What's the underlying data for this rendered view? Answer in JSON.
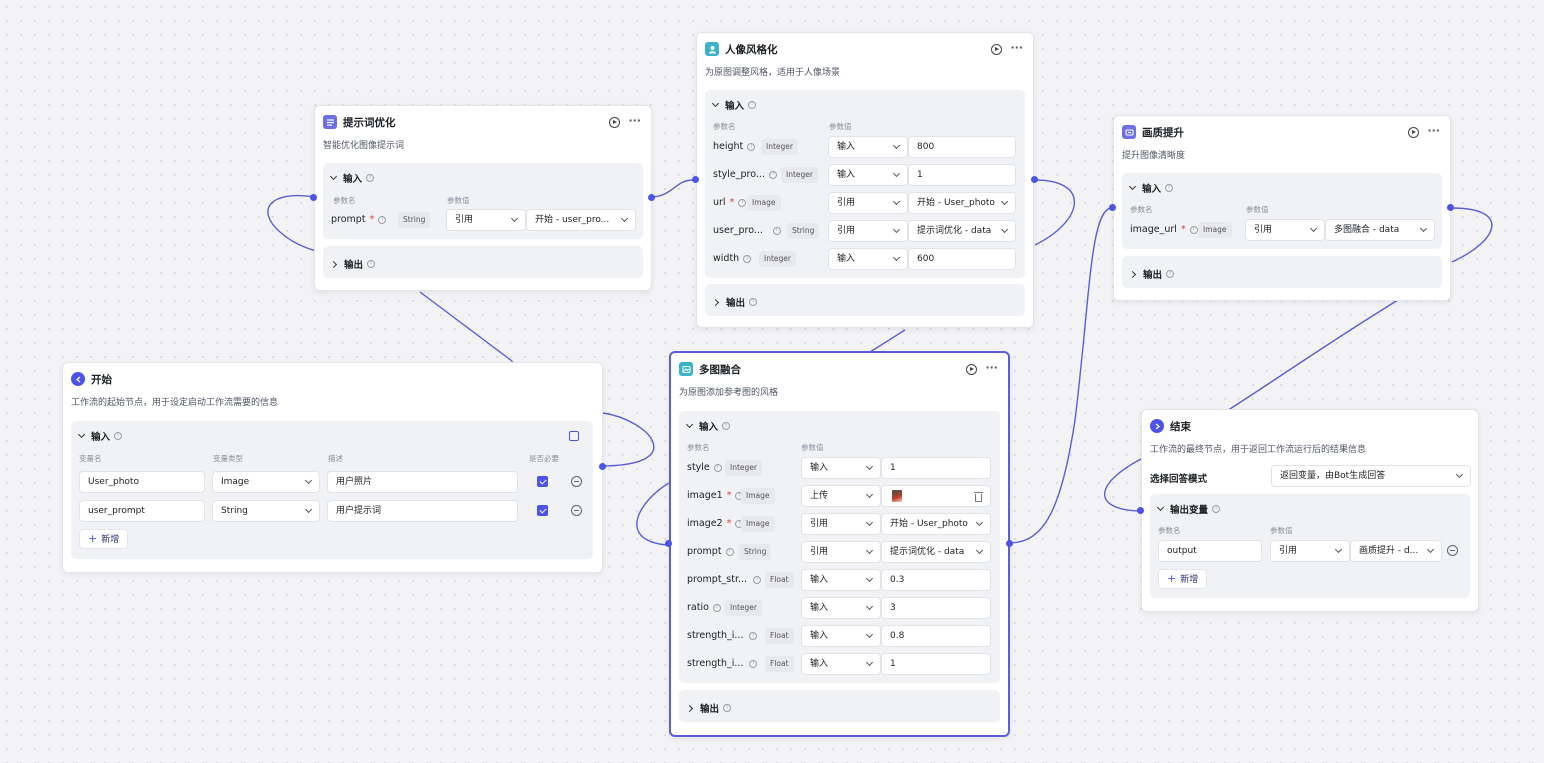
{
  "colors": {
    "accent": "#4d53e8",
    "edge": "#5b5fd6",
    "canvas": "#f3f3f6"
  },
  "nodes": {
    "prompt_opt": {
      "title": "提示词优化",
      "icon": "list-icon",
      "icon_color": "#6d6ee8",
      "desc": "智能优化图像提示词",
      "input_label": "输入",
      "col_name": "参数名",
      "col_value": "参数值",
      "params": [
        {
          "name": "prompt",
          "type": "String",
          "mode": "引用",
          "value": "开始 - user_pro..."
        }
      ],
      "output_label": "输出"
    },
    "portrait": {
      "title": "人像风格化",
      "icon": "person-icon",
      "icon_color": "#38b3c9",
      "desc": "为原图调整风格，适用于人像场景",
      "input_label": "输入",
      "col_name": "参数名",
      "col_value": "参数值",
      "params": [
        {
          "name": "height",
          "type": "Integer",
          "mode": "输入",
          "value": "800"
        },
        {
          "name": "style_pro...",
          "type": "Integer",
          "mode": "输入",
          "value": "1"
        },
        {
          "name": "url",
          "type": "Image",
          "mode": "引用",
          "value": "开始 - User_photo"
        },
        {
          "name": "user_pro...",
          "type": "String",
          "mode": "引用",
          "value": "提示词优化 - data"
        },
        {
          "name": "width",
          "type": "Integer",
          "mode": "输入",
          "value": "600"
        }
      ],
      "output_label": "输出"
    },
    "quality": {
      "title": "画质提升",
      "icon": "image-quality-icon",
      "icon_color": "#6d6ee8",
      "desc": "提升图像清晰度",
      "input_label": "输入",
      "col_name": "参数名",
      "col_value": "参数值",
      "params": [
        {
          "name": "image_url",
          "type": "Image",
          "mode": "引用",
          "value": "多图融合 - data"
        }
      ],
      "output_label": "输出"
    },
    "start": {
      "title": "开始",
      "icon": "start-icon",
      "icon_color": "#4d53e8",
      "desc": "工作流的起始节点，用于设定启动工作流需要的信息",
      "input_label": "输入",
      "cols": [
        "变量名",
        "变量类型",
        "描述",
        "是否必要"
      ],
      "rows": [
        {
          "name": "User_photo",
          "type": "Image",
          "desc": "用户照片"
        },
        {
          "name": "user_prompt",
          "type": "String",
          "desc": "用户提示词"
        }
      ],
      "add_label": "新增"
    },
    "fusion": {
      "title": "多图融合",
      "icon": "fusion-icon",
      "icon_color": "#38b3c9",
      "desc": "为原图添加参考图的风格",
      "input_label": "输入",
      "col_name": "参数名",
      "col_value": "参数值",
      "params": [
        {
          "name": "style",
          "type": "Integer",
          "mode": "输入",
          "value": "1"
        },
        {
          "name": "image1",
          "type": "Image",
          "mode": "上传",
          "value": ""
        },
        {
          "name": "image2",
          "type": "Image",
          "mode": "引用",
          "value": "开始 - User_photo"
        },
        {
          "name": "prompt",
          "type": "String",
          "mode": "引用",
          "value": "提示词优化 - data"
        },
        {
          "name": "prompt_str...",
          "type": "Float",
          "mode": "输入",
          "value": "0.3"
        },
        {
          "name": "ratio",
          "type": "Integer",
          "mode": "输入",
          "value": "3"
        },
        {
          "name": "strength_i...",
          "type": "Float",
          "mode": "输入",
          "value": "0.8"
        },
        {
          "name": "strength_i...",
          "type": "Float",
          "mode": "输入",
          "value": "1"
        }
      ],
      "output_label": "输出"
    },
    "end": {
      "title": "结束",
      "icon": "end-icon",
      "icon_color": "#4d53e8",
      "desc": "工作流的最终节点，用于返回工作流运行后的结果信息",
      "mode_label": "选择回答模式",
      "mode_value": "返回变量，由Bot生成回答",
      "output_var_label": "输出变量",
      "col_name": "参数名",
      "col_value": "参数值",
      "vars": [
        {
          "name": "output",
          "mode": "引用",
          "value": "画质提升 - d..."
        }
      ],
      "add_label": "新增"
    }
  }
}
